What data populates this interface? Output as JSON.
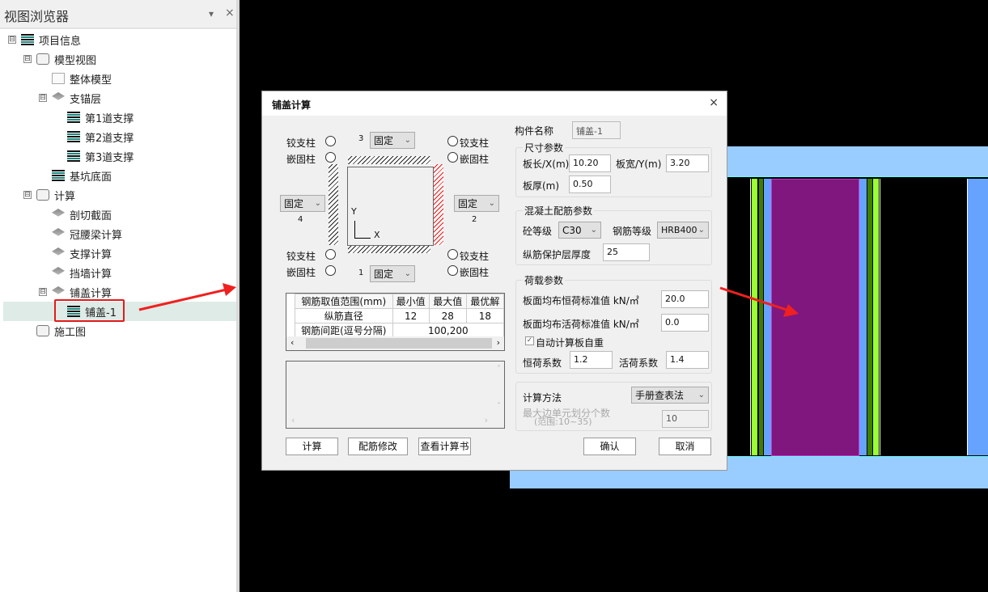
{
  "sidebar": {
    "title": "视图浏览器",
    "dropdown_icon": "▾",
    "close_icon": "×",
    "items": [
      {
        "label": "项目信息",
        "level": 0,
        "icon": "list",
        "expander": "⊟"
      },
      {
        "label": "模型视图",
        "level": 1,
        "icon": "cube",
        "expander": "⊟"
      },
      {
        "label": "整体模型",
        "level": 2,
        "icon": "building"
      },
      {
        "label": "支锚层",
        "level": 2,
        "icon": "layers",
        "expander": "⊟"
      },
      {
        "label": "第1道支撑",
        "level": 3,
        "icon": "list"
      },
      {
        "label": "第2道支撑",
        "level": 3,
        "icon": "list"
      },
      {
        "label": "第3道支撑",
        "level": 3,
        "icon": "list"
      },
      {
        "label": "基坑底面",
        "level": 2,
        "icon": "list"
      },
      {
        "label": "计算",
        "level": 1,
        "icon": "cube",
        "expander": "⊟"
      },
      {
        "label": "剖切截面",
        "level": 2,
        "icon": "layers"
      },
      {
        "label": "冠腰梁计算",
        "level": 2,
        "icon": "layers"
      },
      {
        "label": "支撑计算",
        "level": 2,
        "icon": "layers"
      },
      {
        "label": "挡墙计算",
        "level": 2,
        "icon": "layers"
      },
      {
        "label": "铺盖计算",
        "level": 2,
        "icon": "layers",
        "expander": "⊟"
      },
      {
        "label": "铺盖-1",
        "level": 3,
        "icon": "list",
        "selected": true
      },
      {
        "label": "施工图",
        "level": 1,
        "icon": "cube"
      }
    ]
  },
  "dialog": {
    "title": "铺盖计算",
    "close": "×",
    "supports": {
      "hinge": "铰支柱",
      "fixed_col": "嵌固柱",
      "edge3": {
        "num": "3",
        "value": "固定"
      },
      "edge2": {
        "num": "2",
        "value": "固定"
      },
      "edge4": {
        "num": "4",
        "value": "固定"
      },
      "edge1": {
        "num": "1",
        "value": "固定"
      },
      "axis_x": "X",
      "axis_y": "Y"
    },
    "rebar_table": {
      "headers": [
        "钢筋取值范围(mm)",
        "最小值",
        "最大值",
        "最优解"
      ],
      "rows": [
        [
          "纵筋直径",
          "12",
          "28",
          "18"
        ],
        [
          "钢筋间距(逗号分隔)",
          "100,200"
        ]
      ]
    },
    "buttons": {
      "calc": "计算",
      "modify": "配筋修改",
      "report": "查看计算书",
      "ok": "确认",
      "cancel": "取消"
    },
    "component_name_label": "构件名称",
    "component_name": "铺盖-1",
    "size": {
      "title": "尺寸参数",
      "length_label": "板长/X(m)",
      "length": "10.20",
      "width_label": "板宽/Y(m)",
      "width": "3.20",
      "thick_label": "板厚(m)",
      "thick": "0.50"
    },
    "concrete": {
      "title": "混凝土配筋参数",
      "grade_label": "砼等级",
      "grade": "C30",
      "steel_label": "钢筋等级",
      "steel": "HRB400",
      "cover_label": "纵筋保护层厚度",
      "cover": "25"
    },
    "load": {
      "title": "荷载参数",
      "dead_label": "板面均布恒荷标准值 kN/㎡",
      "dead": "20.0",
      "live_label": "板面均布活荷标准值 kN/㎡",
      "live": "0.0",
      "auto_label": "自动计算板自重",
      "auto_checked": true,
      "dead_factor_label": "恒荷系数",
      "dead_factor": "1.2",
      "live_factor_label": "活荷系数",
      "live_factor": "1.4"
    },
    "method": {
      "label": "计算方法",
      "value": "手册查表法",
      "div_label": "最大边单元划分个数",
      "range": "(范围:10~35)",
      "div": "10"
    }
  },
  "colors": {
    "purple": "#7f177f",
    "lime": "#99ff33",
    "green": "#3f7f00",
    "blue": "#66a3ff",
    "band": "#99ccff",
    "arrow": "#f02020"
  }
}
